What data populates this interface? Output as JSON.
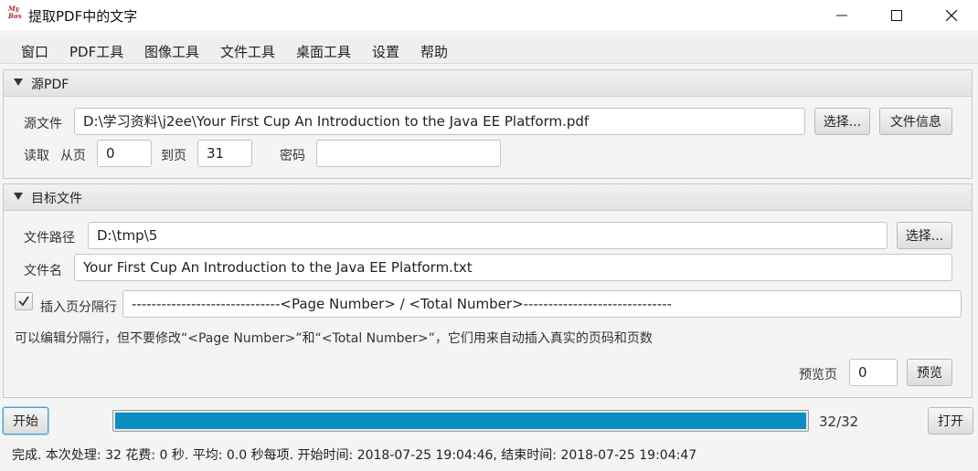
{
  "window": {
    "logo_text": "My Box",
    "title": "提取PDF中的文字"
  },
  "menu": [
    "窗口",
    "PDF工具",
    "图像工具",
    "文件工具",
    "桌面工具",
    "设置",
    "帮助"
  ],
  "source_panel": {
    "title": "源PDF",
    "source_label": "源文件",
    "source_value": "D:\\学习资料\\j2ee\\Your First Cup An Introduction to the Java EE Platform.pdf",
    "select_button": "选择...",
    "info_button": "文件信息",
    "read_label": "读取",
    "from_label": "从页",
    "from_value": "0",
    "to_label": "到页",
    "to_value": "31",
    "password_label": "密码",
    "password_value": ""
  },
  "target_panel": {
    "title": "目标文件",
    "path_label": "文件路径",
    "path_value": "D:\\tmp\\5",
    "select_button": "选择...",
    "name_label": "文件名",
    "name_value": "Your First Cup An Introduction to the Java EE Platform.txt",
    "separator_checked": true,
    "separator_label": "插入页分隔行",
    "separator_value": "------------------------------<Page Number> / <Total Number>------------------------------",
    "hint": "可以编辑分隔行，但不要修改“<Page Number>”和“<Total Number>”，它们用来自动插入真实的页码和页数",
    "preview_label": "预览页",
    "preview_value": "0",
    "preview_button": "预览"
  },
  "bottom": {
    "start_button": "开始",
    "progress": 1.0,
    "progress_text": "32/32",
    "open_button": "打开",
    "status": "完成. 本次处理: 32 花费: 0 秒. 平均: 0.0 秒每项. 开始时间: 2018-07-25 19:04:46, 结束时间: 2018-07-25 19:04:47"
  },
  "colors": {
    "accent": "#0a8fc0",
    "logo": "#b3261e"
  }
}
